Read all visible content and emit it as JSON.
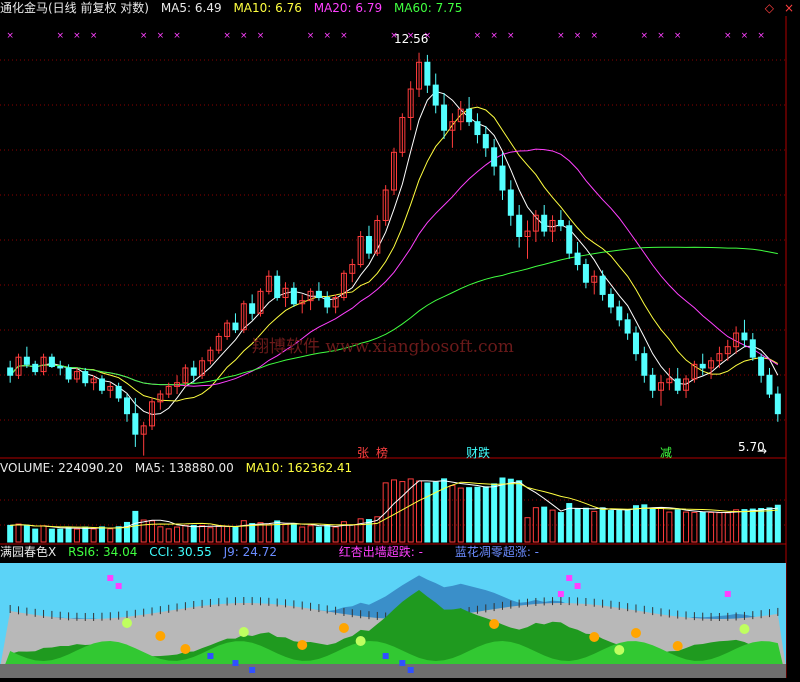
{
  "main_header": {
    "title": "通化金马(日线 前复权 对数)",
    "ma5": "MA5: 6.49",
    "ma10": "MA10: 6.76",
    "ma20": "MA20: 6.79",
    "ma60": "MA60: 7.75"
  },
  "price_labels": {
    "high": "12.56",
    "low": "5.70"
  },
  "event_markers": {
    "zhang": "张",
    "bang": "榜",
    "caidie": "财跌",
    "jian": "减"
  },
  "watermark": "翔博软件 www.xiangbosoft.com",
  "volume_header": {
    "volume": "VOLUME: 224090.20",
    "ma5": "MA5: 138880.00",
    "ma10": "MA10: 162362.41"
  },
  "indicator_header": {
    "name": "满园春色X",
    "rsi6": "RSI6: 34.04",
    "cci": "CCI: 30.55",
    "j9": "J9: 24.72",
    "red_signal": "红杏出墙超跌: -",
    "blue_signal": "蓝花凋零超涨: -"
  },
  "colors": {
    "up": "#ff3c3c",
    "down": "#54ffff",
    "ma5": "#ffffff",
    "ma10": "#ffff40",
    "ma20": "#ff40ff",
    "ma60": "#40ff40",
    "grid": "#8b0000",
    "sky": "#5bd3f7"
  },
  "chart_data": {
    "type": "candlestick",
    "price_range": [
      5.5,
      13.2
    ],
    "candles": [
      [
        6.3,
        6.4,
        6.1,
        6.2
      ],
      [
        6.2,
        6.5,
        6.15,
        6.45
      ],
      [
        6.45,
        6.6,
        6.3,
        6.35
      ],
      [
        6.35,
        6.4,
        6.2,
        6.25
      ],
      [
        6.25,
        6.5,
        6.2,
        6.45
      ],
      [
        6.45,
        6.5,
        6.3,
        6.32
      ],
      [
        6.32,
        6.4,
        6.2,
        6.3
      ],
      [
        6.3,
        6.35,
        6.1,
        6.15
      ],
      [
        6.15,
        6.3,
        6.1,
        6.25
      ],
      [
        6.25,
        6.3,
        6.05,
        6.1
      ],
      [
        6.1,
        6.2,
        6.0,
        6.15
      ],
      [
        6.15,
        6.2,
        5.95,
        6.0
      ],
      [
        6.0,
        6.1,
        5.9,
        6.05
      ],
      [
        6.05,
        6.1,
        5.85,
        5.9
      ],
      [
        5.9,
        5.95,
        5.6,
        5.7
      ],
      [
        5.7,
        5.9,
        5.3,
        5.45
      ],
      [
        5.45,
        5.6,
        5.2,
        5.55
      ],
      [
        5.55,
        5.9,
        5.5,
        5.85
      ],
      [
        5.85,
        6.0,
        5.75,
        5.95
      ],
      [
        5.95,
        6.1,
        5.9,
        6.05
      ],
      [
        6.05,
        6.2,
        5.95,
        6.1
      ],
      [
        6.1,
        6.35,
        6.05,
        6.3
      ],
      [
        6.3,
        6.4,
        6.1,
        6.2
      ],
      [
        6.2,
        6.45,
        6.15,
        6.4
      ],
      [
        6.4,
        6.6,
        6.35,
        6.55
      ],
      [
        6.55,
        6.8,
        6.5,
        6.75
      ],
      [
        6.75,
        7.0,
        6.7,
        6.95
      ],
      [
        6.95,
        7.1,
        6.8,
        6.85
      ],
      [
        6.85,
        7.3,
        6.8,
        7.25
      ],
      [
        7.25,
        7.4,
        7.0,
        7.1
      ],
      [
        7.1,
        7.5,
        7.05,
        7.45
      ],
      [
        7.45,
        7.8,
        7.4,
        7.7
      ],
      [
        7.7,
        7.8,
        7.3,
        7.35
      ],
      [
        7.35,
        7.6,
        7.2,
        7.5
      ],
      [
        7.5,
        7.6,
        7.2,
        7.25
      ],
      [
        7.25,
        7.4,
        7.1,
        7.3
      ],
      [
        7.3,
        7.5,
        7.15,
        7.45
      ],
      [
        7.45,
        7.6,
        7.3,
        7.35
      ],
      [
        7.35,
        7.45,
        7.1,
        7.2
      ],
      [
        7.2,
        7.4,
        7.1,
        7.35
      ],
      [
        7.35,
        7.8,
        7.3,
        7.75
      ],
      [
        7.75,
        8.0,
        7.6,
        7.9
      ],
      [
        7.9,
        8.5,
        7.85,
        8.4
      ],
      [
        8.4,
        8.6,
        8.0,
        8.1
      ],
      [
        8.1,
        8.8,
        8.05,
        8.7
      ],
      [
        8.7,
        9.4,
        8.6,
        9.3
      ],
      [
        9.3,
        10.2,
        9.2,
        10.1
      ],
      [
        10.1,
        11.0,
        10.0,
        10.9
      ],
      [
        10.9,
        11.8,
        10.6,
        11.6
      ],
      [
        11.6,
        12.56,
        11.4,
        12.3
      ],
      [
        12.3,
        12.5,
        11.5,
        11.7
      ],
      [
        11.7,
        12.0,
        11.0,
        11.2
      ],
      [
        11.2,
        11.5,
        10.4,
        10.6
      ],
      [
        10.6,
        11.0,
        10.2,
        10.8
      ],
      [
        10.8,
        11.3,
        10.6,
        11.1
      ],
      [
        11.1,
        11.4,
        10.7,
        10.8
      ],
      [
        10.8,
        11.0,
        10.3,
        10.5
      ],
      [
        10.5,
        10.7,
        10.0,
        10.2
      ],
      [
        10.2,
        10.4,
        9.6,
        9.8
      ],
      [
        9.8,
        10.1,
        9.1,
        9.3
      ],
      [
        9.3,
        9.5,
        8.6,
        8.8
      ],
      [
        8.8,
        9.0,
        8.2,
        8.4
      ],
      [
        8.4,
        8.7,
        8.0,
        8.5
      ],
      [
        8.5,
        8.9,
        8.3,
        8.8
      ],
      [
        8.8,
        9.0,
        8.4,
        8.5
      ],
      [
        8.5,
        8.8,
        8.3,
        8.7
      ],
      [
        8.7,
        8.9,
        8.5,
        8.6
      ],
      [
        8.6,
        8.7,
        8.0,
        8.1
      ],
      [
        8.1,
        8.3,
        7.8,
        7.9
      ],
      [
        7.9,
        8.0,
        7.5,
        7.6
      ],
      [
        7.6,
        7.8,
        7.4,
        7.7
      ],
      [
        7.7,
        7.8,
        7.3,
        7.4
      ],
      [
        7.4,
        7.5,
        7.1,
        7.2
      ],
      [
        7.2,
        7.3,
        6.9,
        7.0
      ],
      [
        7.0,
        7.1,
        6.7,
        6.8
      ],
      [
        6.8,
        6.9,
        6.4,
        6.5
      ],
      [
        6.5,
        6.6,
        6.1,
        6.2
      ],
      [
        6.2,
        6.3,
        5.9,
        6.0
      ],
      [
        6.0,
        6.2,
        5.8,
        6.1
      ],
      [
        6.1,
        6.3,
        6.0,
        6.15
      ],
      [
        6.15,
        6.3,
        5.95,
        6.0
      ],
      [
        6.0,
        6.2,
        5.9,
        6.15
      ],
      [
        6.15,
        6.4,
        6.1,
        6.35
      ],
      [
        6.35,
        6.5,
        6.2,
        6.3
      ],
      [
        6.3,
        6.45,
        6.15,
        6.4
      ],
      [
        6.4,
        6.6,
        6.3,
        6.5
      ],
      [
        6.5,
        6.7,
        6.4,
        6.6
      ],
      [
        6.6,
        6.9,
        6.5,
        6.8
      ],
      [
        6.8,
        7.0,
        6.6,
        6.7
      ],
      [
        6.7,
        6.8,
        6.4,
        6.45
      ],
      [
        6.45,
        6.5,
        6.1,
        6.2
      ],
      [
        6.2,
        6.3,
        5.9,
        5.95
      ],
      [
        5.95,
        6.05,
        5.6,
        5.7
      ]
    ]
  }
}
